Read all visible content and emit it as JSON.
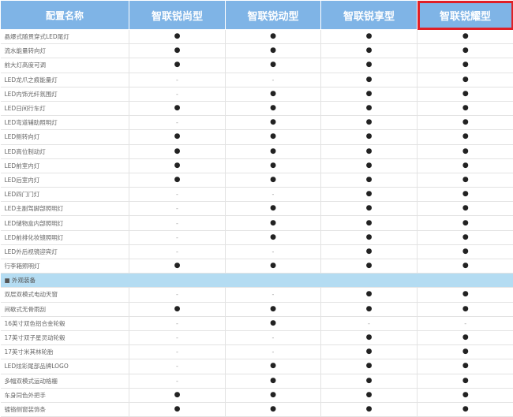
{
  "header": {
    "col0": "配置名称",
    "trims": [
      "智联锐尚型",
      "智联锐动型",
      "智联锐享型",
      "智联锐耀型"
    ],
    "highlight_color": "#e01f26",
    "header_color": "#7fb4e6",
    "section_color": "#b4dcf2"
  },
  "symbols": {
    "yes": "●",
    "no": "-"
  },
  "rows": [
    {
      "name": "晶爆式随贯穿式LED尾灯",
      "v": [
        "●",
        "●",
        "●",
        "●"
      ]
    },
    {
      "name": "流水能量转向灯",
      "v": [
        "●",
        "●",
        "●",
        "●"
      ]
    },
    {
      "name": "前大灯高度可调",
      "v": [
        "●",
        "●",
        "●",
        "●"
      ]
    },
    {
      "name": "LED龙爪之痕能量灯",
      "v": [
        "-",
        "-",
        "●",
        "●"
      ]
    },
    {
      "name": "LED内饰光纤氛围灯",
      "v": [
        "-",
        "●",
        "●",
        "●"
      ]
    },
    {
      "name": "LED日间行车灯",
      "v": [
        "●",
        "●",
        "●",
        "●"
      ]
    },
    {
      "name": "LED弯道辅助照明灯",
      "v": [
        "-",
        "●",
        "●",
        "●"
      ]
    },
    {
      "name": "LED侧转向灯",
      "v": [
        "●",
        "●",
        "●",
        "●"
      ]
    },
    {
      "name": "LED高位制动灯",
      "v": [
        "●",
        "●",
        "●",
        "●"
      ]
    },
    {
      "name": "LED前室内灯",
      "v": [
        "●",
        "●",
        "●",
        "●"
      ]
    },
    {
      "name": "LED后室内灯",
      "v": [
        "●",
        "●",
        "●",
        "●"
      ]
    },
    {
      "name": "LED四门门灯",
      "v": [
        "-",
        "-",
        "●",
        "●"
      ]
    },
    {
      "name": "LED主副驾脚部照明灯",
      "v": [
        "-",
        "●",
        "●",
        "●"
      ]
    },
    {
      "name": "LED储物盒内部照明灯",
      "v": [
        "-",
        "●",
        "●",
        "●"
      ]
    },
    {
      "name": "LED前排化妆镜照明灯",
      "v": [
        "-",
        "●",
        "●",
        "●"
      ]
    },
    {
      "name": "LED外后视镜迎宾灯",
      "v": [
        "-",
        "-",
        "●",
        "●"
      ]
    },
    {
      "name": "行李箱照明灯",
      "v": [
        "●",
        "●",
        "●",
        "●"
      ]
    }
  ],
  "section": {
    "label": "■ 外观装备"
  },
  "rows2": [
    {
      "name": "双层双模式电动天窗",
      "v": [
        "-",
        "-",
        "●",
        "●"
      ]
    },
    {
      "name": "间歇式无骨雨刮",
      "v": [
        "●",
        "●",
        "●",
        "●"
      ]
    },
    {
      "name": "16英寸双色铝合金轮毂",
      "v": [
        "-",
        "●",
        "-",
        "-"
      ]
    },
    {
      "name": "17英寸双子星灵动轮毂",
      "v": [
        "-",
        "-",
        "●",
        "●"
      ]
    },
    {
      "name": "17英寸米其林轮胎",
      "v": [
        "-",
        "-",
        "●",
        "●"
      ]
    },
    {
      "name": "LED炫彩尾部品牌LOGO",
      "v": [
        "-",
        "●",
        "●",
        "●"
      ]
    },
    {
      "name": "多幅双模式运动格栅",
      "v": [
        "-",
        "●",
        "●",
        "●"
      ]
    },
    {
      "name": "车身同色外把手",
      "v": [
        "●",
        "●",
        "●",
        "●"
      ]
    },
    {
      "name": "镀铬侧窗装饰条",
      "v": [
        "●",
        "●",
        "●",
        "●"
      ]
    }
  ]
}
